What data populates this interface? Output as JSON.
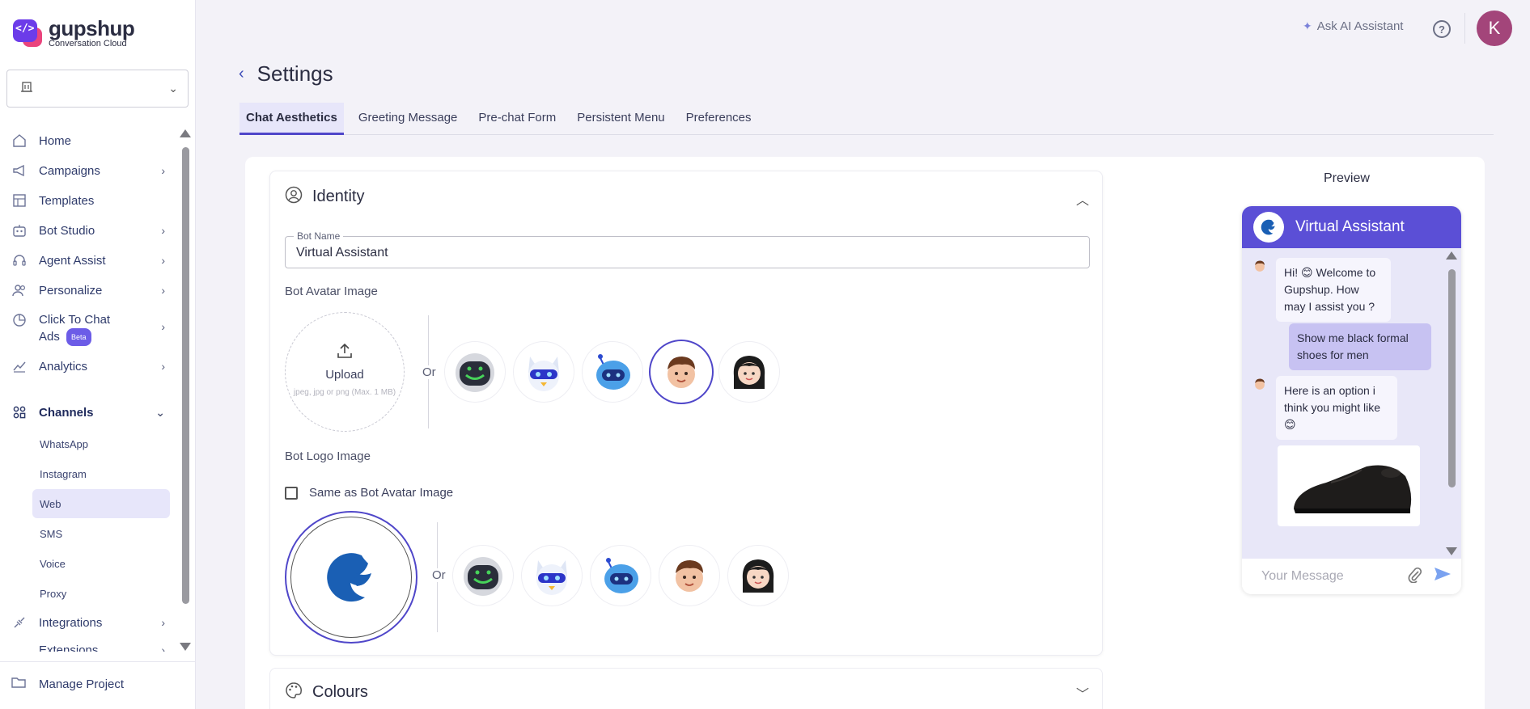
{
  "brand": {
    "name": "gupshup",
    "tagline": "Conversation Cloud"
  },
  "sidebar": {
    "items": [
      {
        "label": "Home",
        "icon": "home-icon"
      },
      {
        "label": "Campaigns",
        "icon": "megaphone-icon"
      },
      {
        "label": "Templates",
        "icon": "templates-icon"
      },
      {
        "label": "Bot Studio",
        "icon": "bot-icon"
      },
      {
        "label": "Agent Assist",
        "icon": "headset-icon"
      },
      {
        "label": "Personalize",
        "icon": "users-icon"
      },
      {
        "label": "Click To Chat",
        "label2": "Ads",
        "badge": "Beta",
        "icon": "chart-pie-icon"
      },
      {
        "label": "Analytics",
        "icon": "line-chart-icon"
      },
      {
        "label": "Channels",
        "icon": "channels-icon"
      },
      {
        "label": "Integrations",
        "icon": "plug-icon"
      },
      {
        "label": "Extensions",
        "icon": "extensions-icon"
      }
    ],
    "channels": [
      "WhatsApp",
      "Instagram",
      "Web",
      "SMS",
      "Voice",
      "Proxy"
    ],
    "active_channel": "Web",
    "footer": "Manage Project"
  },
  "topbar": {
    "ask_ai": "Ask AI Assistant",
    "help": "?",
    "avatar_initial": "K"
  },
  "page": {
    "title": "Settings"
  },
  "tabs": [
    "Chat Aesthetics",
    "Greeting Message",
    "Pre-chat Form",
    "Persistent Menu",
    "Preferences"
  ],
  "identity": {
    "title": "Identity",
    "bot_name_label": "Bot Name",
    "bot_name_value": "Virtual Assistant",
    "avatar_label": "Bot Avatar Image",
    "upload_label": "Upload",
    "upload_hint": "jpeg, jpg or png (Max. 1 MB)",
    "or": "Or",
    "logo_label": "Bot Logo Image",
    "same_as_avatar": "Same as Bot Avatar Image"
  },
  "colours": {
    "title": "Colours"
  },
  "preview": {
    "title": "Preview",
    "bot_name": "Virtual Assistant",
    "messages": {
      "greeting": "Hi! 😊 Welcome to Gupshup. How may I assist you ?",
      "user": "Show me black formal shoes for men",
      "reply": "Here is an option i think you might like 😊"
    },
    "input_placeholder": "Your Message"
  },
  "colors": {
    "accent": "#5b4fd6",
    "active_tab_bg": "#e7e6fa",
    "avatar_bg": "#a3457a"
  }
}
